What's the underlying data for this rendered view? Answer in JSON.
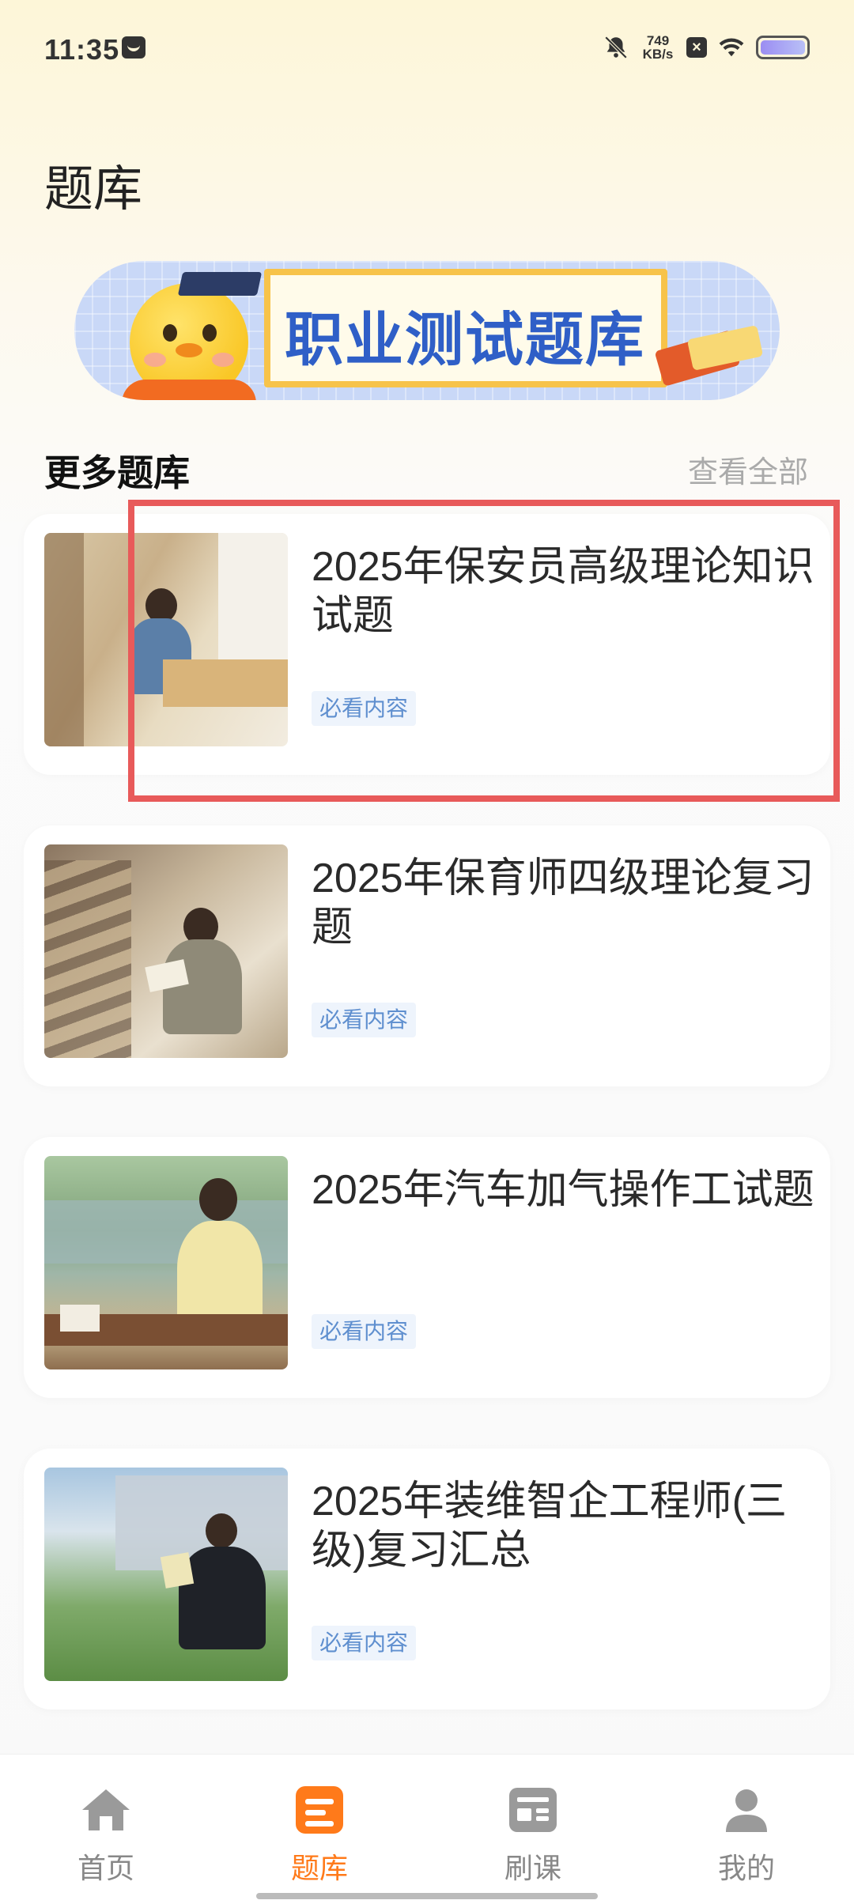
{
  "status_bar": {
    "time": "11:35",
    "net_speed_value": "749",
    "net_speed_unit": "KB/s"
  },
  "page": {
    "title": "题库"
  },
  "banner": {
    "text": "职业测试题库"
  },
  "section": {
    "title": "更多题库",
    "view_all": "查看全部"
  },
  "cards": [
    {
      "title": "2025年保安员高级理论知识试题",
      "tag": "必看内容"
    },
    {
      "title": "2025年保育师四级理论复习题",
      "tag": "必看内容"
    },
    {
      "title": "2025年汽车加气操作工试题",
      "tag": "必看内容"
    },
    {
      "title": "2025年装维智企工程师(三级)复习汇总",
      "tag": "必看内容"
    }
  ],
  "tabs": [
    {
      "label": "首页",
      "icon": "home-icon",
      "active": false
    },
    {
      "label": "题库",
      "icon": "question-bank-icon",
      "active": true
    },
    {
      "label": "刷课",
      "icon": "course-icon",
      "active": false
    },
    {
      "label": "我的",
      "icon": "profile-icon",
      "active": false
    }
  ],
  "colors": {
    "accent": "#ff7a1a",
    "tag_text": "#5f8fcf",
    "tag_bg": "#eef4fc",
    "highlight": "#e85a5a"
  }
}
